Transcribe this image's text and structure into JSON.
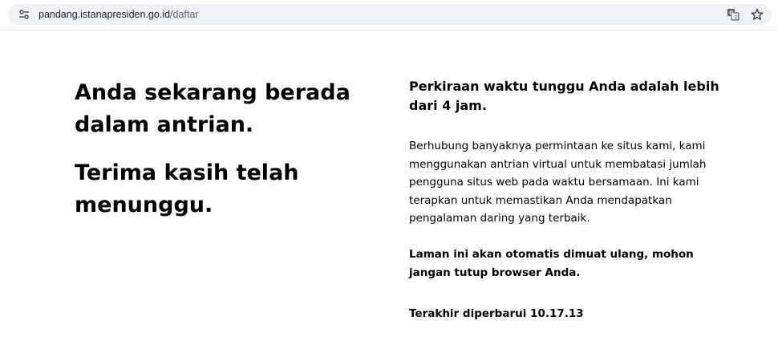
{
  "browser": {
    "url_host": "pandang.istanapresiden.go.id",
    "url_path": "/daftar",
    "icons": {
      "site_info": "site-settings-icon",
      "translate": "translate-icon",
      "bookmark": "star-icon"
    }
  },
  "queue": {
    "heading_queue": "Anda sekarang berada dalam antrian.",
    "heading_thanks": "Terima kasih telah menunggu.",
    "wait_estimate": "Perkiraan waktu tunggu Anda adalah lebih dari 4 jam.",
    "explanation": "Berhubung banyaknya permintaan ke situs kami, kami menggunakan antrian virtual untuk membatasi jumlah pengguna situs web pada waktu bersamaan. Ini kami terapkan untuk memastikan Anda mendapatkan pengalaman daring yang terbaik.",
    "auto_reload_notice": "Laman ini akan otomatis dimuat ulang, mohon jangan tutup browser Anda.",
    "last_updated": "Terakhir diperbarui 10.17.13"
  }
}
